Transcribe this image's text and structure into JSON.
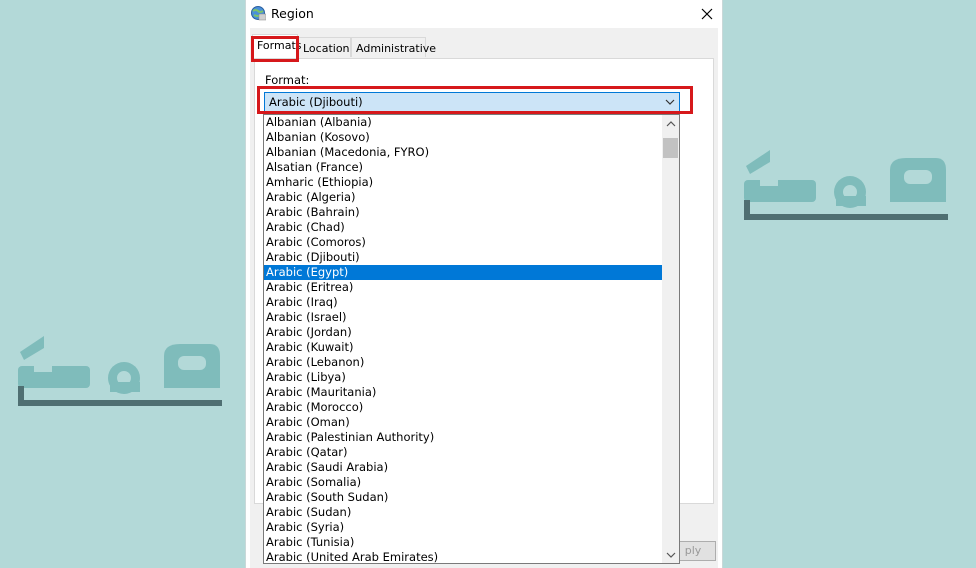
{
  "window": {
    "title": "Region"
  },
  "tabs": [
    {
      "label": "Formats",
      "active": true
    },
    {
      "label": "Location",
      "active": false
    },
    {
      "label": "Administrative",
      "active": false
    }
  ],
  "format": {
    "label": "Format:",
    "selected_value": "Arabic (Djibouti)"
  },
  "dropdown": {
    "items": [
      "Albanian (Albania)",
      "Albanian (Kosovo)",
      "Albanian (Macedonia, FYRO)",
      "Alsatian (France)",
      "Amharic (Ethiopia)",
      "Arabic (Algeria)",
      "Arabic (Bahrain)",
      "Arabic (Chad)",
      "Arabic (Comoros)",
      "Arabic (Djibouti)",
      "Arabic (Egypt)",
      "Arabic (Eritrea)",
      "Arabic (Iraq)",
      "Arabic (Israel)",
      "Arabic (Jordan)",
      "Arabic (Kuwait)",
      "Arabic (Lebanon)",
      "Arabic (Libya)",
      "Arabic (Mauritania)",
      "Arabic (Morocco)",
      "Arabic (Oman)",
      "Arabic (Palestinian Authority)",
      "Arabic (Qatar)",
      "Arabic (Saudi Arabia)",
      "Arabic (Somalia)",
      "Arabic (South Sudan)",
      "Arabic (Sudan)",
      "Arabic (Syria)",
      "Arabic (Tunisia)",
      "Arabic (United Arab Emirates)"
    ],
    "highlighted_item": "Arabic (Egypt)"
  },
  "buttons": {
    "apply_partial": "ply"
  },
  "colors": {
    "background": "#b3d9d8",
    "highlight_box": "#d6181b",
    "selection": "#0078d7",
    "logo_teal": "#7fbcbb",
    "logo_dark": "#4f6f72"
  },
  "icons": {
    "app": "region-globe-icon",
    "close": "close-icon",
    "chevron": "chevron-down-icon",
    "scroll_up": "chevron-up-icon",
    "scroll_down": "chevron-down-icon"
  }
}
